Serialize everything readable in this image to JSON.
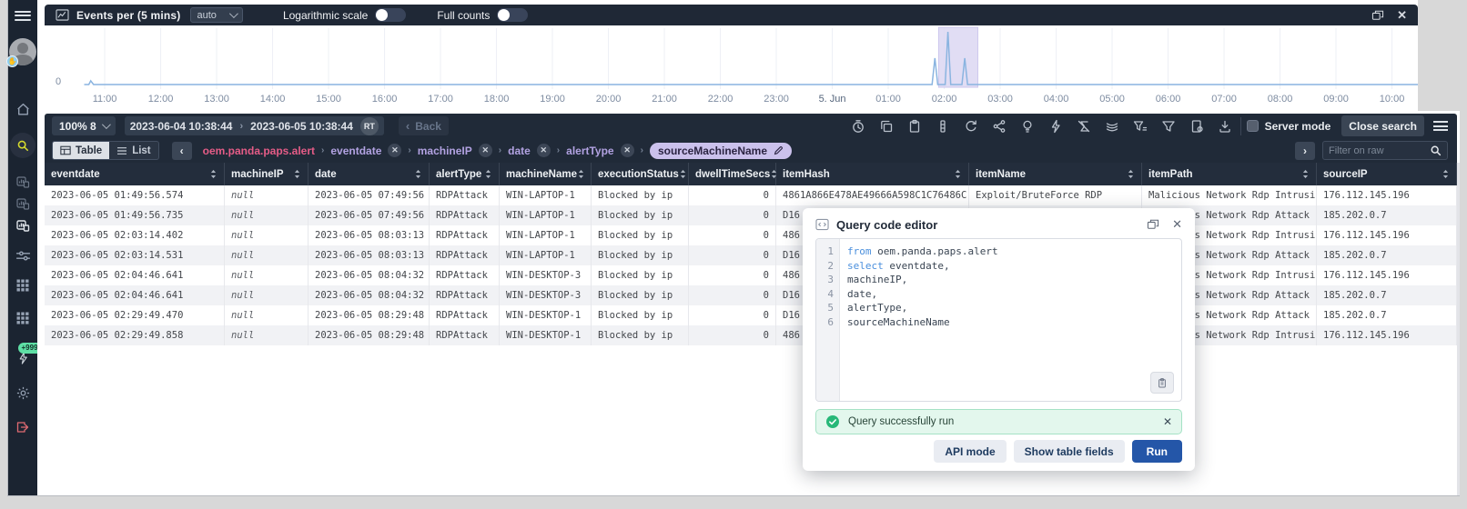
{
  "colors": {
    "accent_blue": "#2456a8",
    "line_blue": "#8ab4e0",
    "band_purple": "#dcd8f3",
    "pink_table": "#e55c87",
    "lavender_field": "#b2a2e2",
    "success_green": "#27b878",
    "dark_bar": "#202a38",
    "sidebar": "#1b2431",
    "search_active_yellow": "#d4d92e",
    "logout_red": "#e06a72"
  },
  "sidebar": {
    "icons": [
      "menu",
      "avatar",
      "home",
      "search",
      "data-search-1",
      "data-search-2",
      "data-search-3",
      "sliders",
      "apps-grid-1",
      "apps-grid-2",
      "activity-bolt",
      "settings",
      "logout"
    ],
    "badge_999": "+999"
  },
  "chart_panel": {
    "icon": "line-chart-icon",
    "title": "Events per (5 mins)",
    "interval_value": "auto",
    "log_label": "Logarithmic scale",
    "full_counts_label": "Full counts",
    "y_axis_zero": "0",
    "header_icons": [
      "popout-window-icon",
      "close-icon"
    ]
  },
  "chart_data": {
    "type": "line",
    "title": "Events per (5 mins)",
    "x_start": "2023-06-04 10:38:44",
    "x_end": "2023-06-05 10:38:44",
    "y_min_label": "0",
    "grid": true,
    "line_color": "#8ab4e0",
    "ticks": [
      {
        "label": "11:00",
        "m": 22
      },
      {
        "label": "12:00",
        "m": 82
      },
      {
        "label": "13:00",
        "m": 142
      },
      {
        "label": "14:00",
        "m": 202
      },
      {
        "label": "15:00",
        "m": 262
      },
      {
        "label": "16:00",
        "m": 322
      },
      {
        "label": "17:00",
        "m": 382
      },
      {
        "label": "18:00",
        "m": 442
      },
      {
        "label": "19:00",
        "m": 502
      },
      {
        "label": "20:00",
        "m": 562
      },
      {
        "label": "21:00",
        "m": 622
      },
      {
        "label": "22:00",
        "m": 682
      },
      {
        "label": "23:00",
        "m": 742
      },
      {
        "label": "5. Jun",
        "m": 802,
        "em": true
      },
      {
        "label": "01:00",
        "m": 862
      },
      {
        "label": "02:00",
        "m": 922
      },
      {
        "label": "03:00",
        "m": 982
      },
      {
        "label": "04:00",
        "m": 1042
      },
      {
        "label": "05:00",
        "m": 1102
      },
      {
        "label": "06:00",
        "m": 1162
      },
      {
        "label": "07:00",
        "m": 1222
      },
      {
        "label": "08:00",
        "m": 1282
      },
      {
        "label": "09:00",
        "m": 1342
      },
      {
        "label": "10:00",
        "m": 1402
      }
    ],
    "points": [
      {
        "m": 0,
        "v": 0
      },
      {
        "m": 5,
        "v": 0
      },
      {
        "m": 7,
        "v": 0.07
      },
      {
        "m": 10,
        "v": 0
      },
      {
        "m": 909,
        "v": 0
      },
      {
        "m": 912,
        "v": 0.5
      },
      {
        "m": 915,
        "v": 0
      },
      {
        "m": 923,
        "v": 0
      },
      {
        "m": 926,
        "v": 1
      },
      {
        "m": 929,
        "v": 0
      },
      {
        "m": 941,
        "v": 0
      },
      {
        "m": 944,
        "v": 0.5
      },
      {
        "m": 947,
        "v": 0
      },
      {
        "m": 1440,
        "v": 0
      }
    ],
    "selection_band": {
      "from_m": 916,
      "to_m": 958
    }
  },
  "toolbar": {
    "zoom_selector": "100% 8",
    "date_from": "2023-06-04 10:38:44",
    "date_to": "2023-06-05 10:38:44",
    "rt_badge": "RT",
    "back_label": "Back",
    "icons": [
      "history",
      "copy",
      "clipboard",
      "columns",
      "rotate",
      "share-nodes",
      "idea",
      "bolt",
      "no-group",
      "layers",
      "filter-values",
      "funnel",
      "file-export",
      "download"
    ],
    "server_mode_label": "Server mode",
    "close_search_label": "Close search"
  },
  "view_bar": {
    "table_label": "Table",
    "list_label": "List",
    "root_table": "oem.panda.paps.alert",
    "fields": [
      "eventdate",
      "machineIP",
      "date",
      "alertType"
    ],
    "active_field": "sourceMachineName",
    "filter_placeholder": "Filter on raw"
  },
  "table": {
    "columns": [
      "eventdate",
      "machineIP",
      "date",
      "alertType",
      "machineName",
      "executionStatus",
      "dwellTimeSecs",
      "itemHash",
      "itemName",
      "itemPath",
      "sourceIP"
    ],
    "rows": [
      [
        "2023-06-05 01:49:56.574",
        "null",
        "2023-06-05 07:49:56",
        "RDPAttack",
        "WIN-LAPTOP-1",
        "Blocked by ip",
        "0",
        "4861A866E478AE49666A598C1C76486C",
        "Exploit/BruteForce RDP",
        "Malicious Network Rdp Intrusion",
        "176.112.145.196"
      ],
      [
        "2023-06-05 01:49:56.735",
        "null",
        "2023-06-05 07:49:56",
        "RDPAttack",
        "WIN-LAPTOP-1",
        "Blocked by ip",
        "0",
        "D16",
        "",
        "Malicious Network Rdp Attack",
        "185.202.0.7"
      ],
      [
        "2023-06-05 02:03:14.402",
        "null",
        "2023-06-05 08:03:13",
        "RDPAttack",
        "WIN-LAPTOP-1",
        "Blocked by ip",
        "0",
        "486",
        "",
        "Malicious Network Rdp Intrusion",
        "176.112.145.196"
      ],
      [
        "2023-06-05 02:03:14.531",
        "null",
        "2023-06-05 08:03:13",
        "RDPAttack",
        "WIN-LAPTOP-1",
        "Blocked by ip",
        "0",
        "D16",
        "",
        "Malicious Network Rdp Attack",
        "185.202.0.7"
      ],
      [
        "2023-06-05 02:04:46.641",
        "null",
        "2023-06-05 08:04:32",
        "RDPAttack",
        "WIN-DESKTOP-3",
        "Blocked by ip",
        "0",
        "486",
        "",
        "Malicious Network Rdp Intrusion",
        "176.112.145.196"
      ],
      [
        "2023-06-05 02:04:46.641",
        "null",
        "2023-06-05 08:04:32",
        "RDPAttack",
        "WIN-DESKTOP-3",
        "Blocked by ip",
        "0",
        "D16",
        "",
        "Malicious Network Rdp Attack",
        "185.202.0.7"
      ],
      [
        "2023-06-05 02:29:49.470",
        "null",
        "2023-06-05 08:29:48",
        "RDPAttack",
        "WIN-DESKTOP-1",
        "Blocked by ip",
        "0",
        "D16",
        "",
        "Malicious Network Rdp Attack",
        "185.202.0.7"
      ],
      [
        "2023-06-05 02:29:49.858",
        "null",
        "2023-06-05 08:29:48",
        "RDPAttack",
        "WIN-DESKTOP-1",
        "Blocked by ip",
        "0",
        "486",
        "",
        "Malicious Network Rdp Intrusion",
        "176.112.145.196"
      ]
    ]
  },
  "modal": {
    "icon": "code-editor-icon",
    "title": "Query code editor",
    "header_icons": [
      "popout-window-icon",
      "close-icon"
    ],
    "code": [
      {
        "line": "1",
        "keyword": "from",
        "text": "oem.panda.paps.alert"
      },
      {
        "line": "2",
        "keyword": "select",
        "text": "eventdate,"
      },
      {
        "line": "3",
        "keyword": "",
        "text": "machineIP,"
      },
      {
        "line": "4",
        "keyword": "",
        "text": "date,"
      },
      {
        "line": "5",
        "keyword": "",
        "text": "alertType,"
      },
      {
        "line": "6",
        "keyword": "",
        "text": "sourceMachineName"
      }
    ],
    "copy_icon": "clipboard-icon",
    "success_message": "Query successfully run",
    "buttons": {
      "api": "API mode",
      "fields": "Show table fields",
      "run": "Run"
    }
  }
}
